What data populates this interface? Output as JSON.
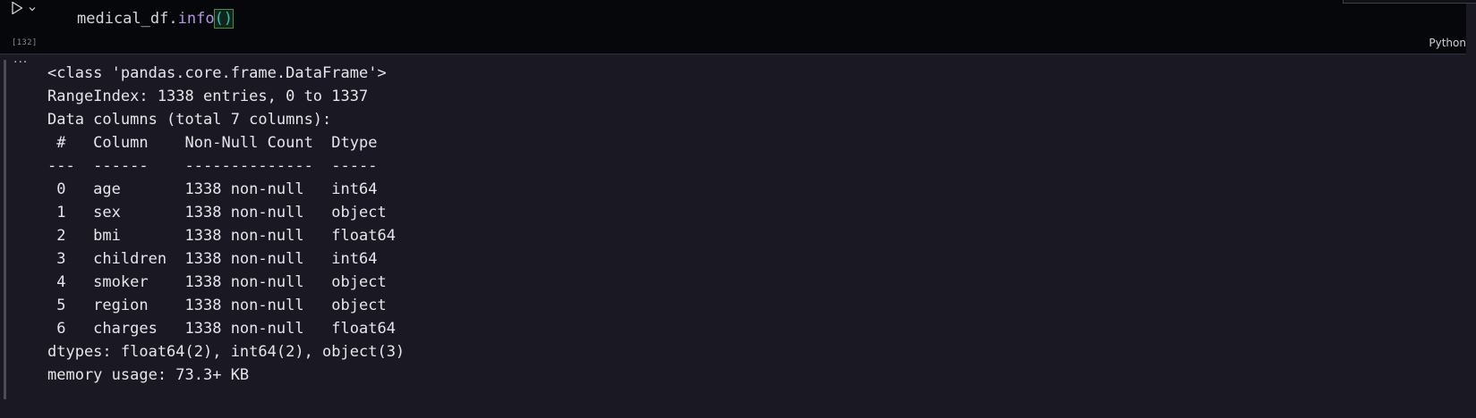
{
  "cell": {
    "execution_count": "[132]",
    "language": "Python",
    "code": {
      "object": "medical_df",
      "dot": ".",
      "method": "info",
      "parens": "()"
    }
  },
  "output": {
    "menu_glyph": "···",
    "lines": [
      "<class 'pandas.core.frame.DataFrame'>",
      "RangeIndex: 1338 entries, 0 to 1337",
      "Data columns (total 7 columns):",
      " #   Column    Non-Null Count  Dtype  ",
      "---  ------    --------------  -----  ",
      " 0   age       1338 non-null   int64  ",
      " 1   sex       1338 non-null   object ",
      " 2   bmi       1338 non-null   float64",
      " 3   children  1338 non-null   int64  ",
      " 4   smoker    1338 non-null   object ",
      " 5   region    1338 non-null   object ",
      " 6   charges   1338 non-null   float64",
      "dtypes: float64(2), int64(2), object(3)",
      "memory usage: 73.3+ KB"
    ]
  },
  "icons": {
    "run": "play-icon",
    "run_menu": "chevron-down-icon",
    "output_menu": "ellipsis-icon"
  },
  "colors": {
    "background": "#1a1822",
    "editor_background": "#06070b",
    "method": "#b796e6",
    "bracket": "#29c7a6"
  }
}
